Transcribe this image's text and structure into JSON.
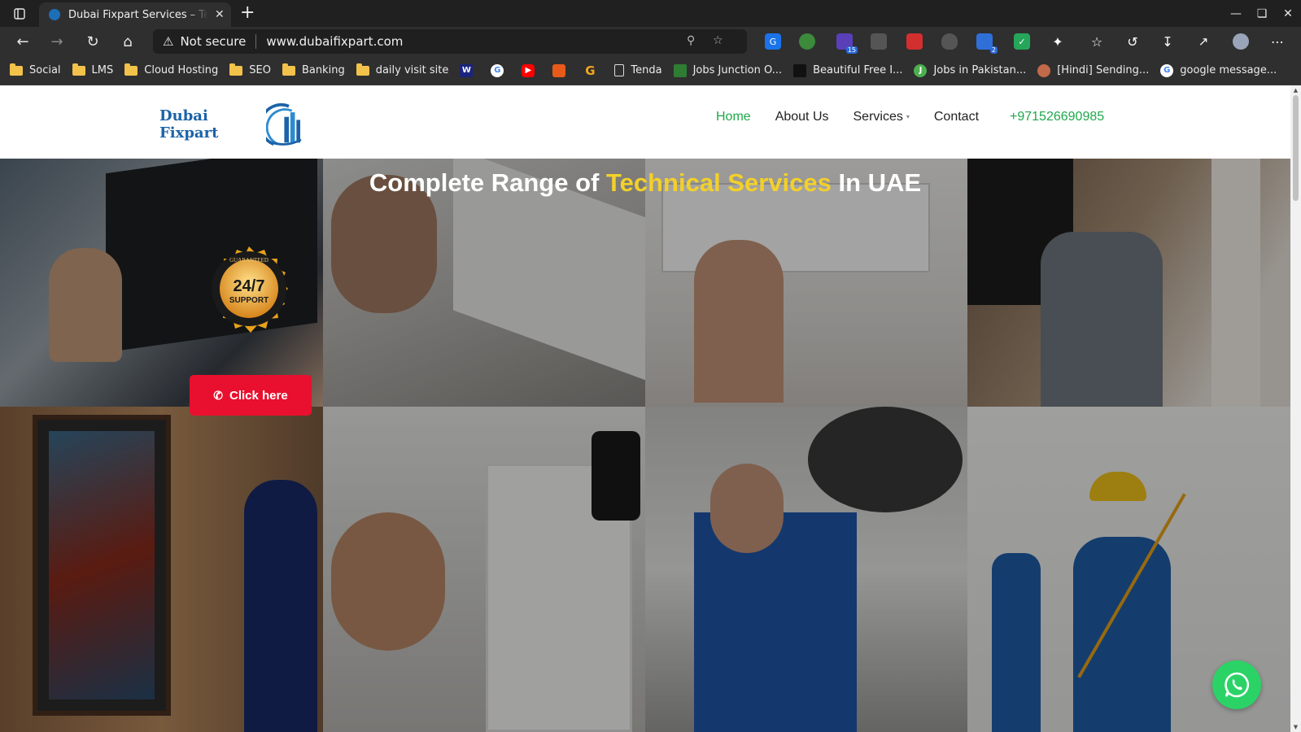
{
  "browser": {
    "tab_title": "Dubai Fixpart Services – Technical Services in UAE",
    "tab_close": "✕",
    "new_tab": "+",
    "security_label": "Not secure",
    "url": "www.dubaifixpart.com",
    "bookmarks": [
      {
        "label": "Social",
        "kind": "folder"
      },
      {
        "label": "LMS",
        "kind": "folder"
      },
      {
        "label": "Cloud Hosting",
        "kind": "folder"
      },
      {
        "label": "SEO",
        "kind": "folder"
      },
      {
        "label": "Banking",
        "kind": "folder"
      },
      {
        "label": "daily visit site",
        "kind": "folder"
      },
      {
        "label": "Tenda",
        "kind": "page"
      },
      {
        "label": "Jobs Junction O...",
        "kind": "site"
      },
      {
        "label": "Beautiful Free I...",
        "kind": "site"
      },
      {
        "label": "Jobs in Pakistan...",
        "kind": "site"
      },
      {
        "label": "[Hindi] Sending...",
        "kind": "site"
      },
      {
        "label": "google message...",
        "kind": "site"
      }
    ],
    "extension_badges": {
      "ext3": "15",
      "ext5": "2"
    }
  },
  "site": {
    "logo_text": "Dubai Fixpart",
    "nav": {
      "home": "Home",
      "about": "About Us",
      "services": "Services",
      "contact": "Contact",
      "phone": "+971526690985"
    },
    "hero": {
      "title_pre": "Complete Range of ",
      "title_accent": "Technical Services",
      "title_post": " In UAE",
      "badge_main": "24/7",
      "badge_sub": "SUPPORT",
      "badge_ring": "GUARANTEED",
      "cta": "Click here"
    }
  },
  "colors": {
    "accent_green": "#1ea84a",
    "accent_yellow": "#f3d02a",
    "cta_red": "#e8102e",
    "logo_blue": "#1b63a8",
    "whatsapp": "#2bd366"
  }
}
